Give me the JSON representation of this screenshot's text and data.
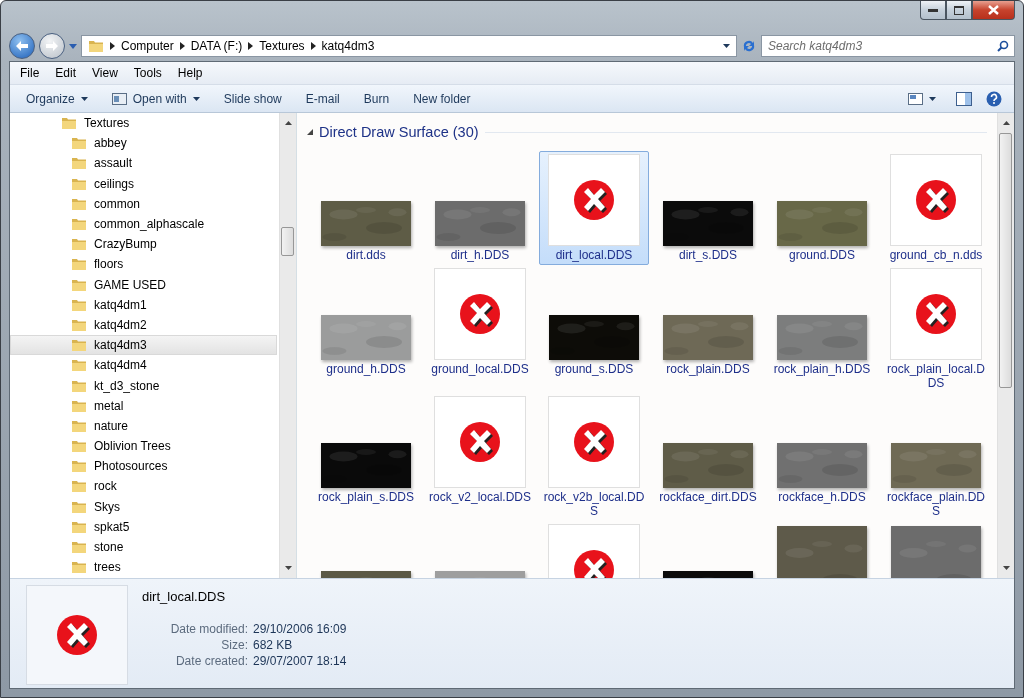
{
  "address": {
    "path": [
      "Computer",
      "DATA (F:)",
      "Textures",
      "katq4dm3"
    ]
  },
  "search": {
    "placeholder": "Search katq4dm3"
  },
  "menu": [
    "File",
    "Edit",
    "View",
    "Tools",
    "Help"
  ],
  "toolbar": [
    {
      "label": "Organize",
      "kind": "menu"
    },
    {
      "label": "Open with",
      "kind": "app-menu"
    },
    {
      "label": "Slide show",
      "kind": "plain"
    },
    {
      "label": "E-mail",
      "kind": "plain"
    },
    {
      "label": "Burn",
      "kind": "plain"
    },
    {
      "label": "New folder",
      "kind": "plain"
    }
  ],
  "sidebar": {
    "items": [
      {
        "label": "Textures",
        "selected": false,
        "children": [
          {
            "label": "abbey",
            "selected": false
          },
          {
            "label": "assault",
            "selected": false
          },
          {
            "label": "ceilings",
            "selected": false
          },
          {
            "label": "common",
            "selected": false
          },
          {
            "label": "common_alphascale",
            "selected": false
          },
          {
            "label": "CrazyBump",
            "selected": false
          },
          {
            "label": "floors",
            "selected": false
          },
          {
            "label": "GAME USED",
            "selected": false
          },
          {
            "label": "katq4dm1",
            "selected": false
          },
          {
            "label": "katq4dm2",
            "selected": false
          },
          {
            "label": "katq4dm3",
            "selected": true
          },
          {
            "label": "katq4dm4",
            "selected": false
          },
          {
            "label": "kt_d3_stone",
            "selected": false
          },
          {
            "label": "metal",
            "selected": false
          },
          {
            "label": "nature",
            "selected": false
          },
          {
            "label": "Oblivion Trees",
            "selected": false
          },
          {
            "label": "Photosources",
            "selected": false
          },
          {
            "label": "rock",
            "selected": false
          },
          {
            "label": "Skys",
            "selected": false
          },
          {
            "label": "spkat5",
            "selected": false
          },
          {
            "label": "stone",
            "selected": false
          },
          {
            "label": "trees",
            "selected": false
          }
        ]
      }
    ]
  },
  "group": {
    "title": "Direct Draw Surface (30)",
    "expanded": true
  },
  "files": [
    {
      "name": "dirt.dds",
      "kind": "texture",
      "selected": false
    },
    {
      "name": "dirt_h.DDS",
      "kind": "texture",
      "selected": false
    },
    {
      "name": "dirt_local.DDS",
      "kind": "error",
      "selected": true
    },
    {
      "name": "dirt_s.DDS",
      "kind": "texture",
      "selected": false
    },
    {
      "name": "ground.DDS",
      "kind": "texture",
      "selected": false
    },
    {
      "name": "ground_cb_n.dds",
      "kind": "error",
      "selected": false
    },
    {
      "name": "ground_h.DDS",
      "kind": "texture",
      "selected": false
    },
    {
      "name": "ground_local.DDS",
      "kind": "error",
      "selected": false
    },
    {
      "name": "ground_s.DDS",
      "kind": "texture",
      "selected": false
    },
    {
      "name": "rock_plain.DDS",
      "kind": "texture",
      "selected": false
    },
    {
      "name": "rock_plain_h.DDS",
      "kind": "texture",
      "selected": false
    },
    {
      "name": "rock_plain_local.DDS",
      "kind": "error",
      "selected": false
    },
    {
      "name": "rock_plain_s.DDS",
      "kind": "texture",
      "selected": false
    },
    {
      "name": "rock_v2_local.DDS",
      "kind": "error",
      "selected": false
    },
    {
      "name": "rock_v2b_local.DDS",
      "kind": "error",
      "selected": false
    },
    {
      "name": "rockface_dirt.DDS",
      "kind": "texture",
      "selected": false
    },
    {
      "name": "rockface_h.DDS",
      "kind": "texture",
      "selected": false
    },
    {
      "name": "rockface_plain.DDS",
      "kind": "texture",
      "selected": false
    },
    {
      "kind": "texture",
      "selected": false
    },
    {
      "kind": "texture",
      "selected": false
    },
    {
      "kind": "error",
      "selected": false
    },
    {
      "kind": "texture",
      "selected": false
    },
    {
      "kind": "square",
      "selected": false
    },
    {
      "kind": "square",
      "selected": false
    }
  ],
  "details": {
    "name": "dirt_local.DDS",
    "kind": "error",
    "properties": [
      {
        "label": "Date modified:",
        "value": "29/10/2006 16:09"
      },
      {
        "label": "Size:",
        "value": "682 KB"
      },
      {
        "label": "Date created:",
        "value": "29/07/2007 18:14"
      }
    ]
  }
}
